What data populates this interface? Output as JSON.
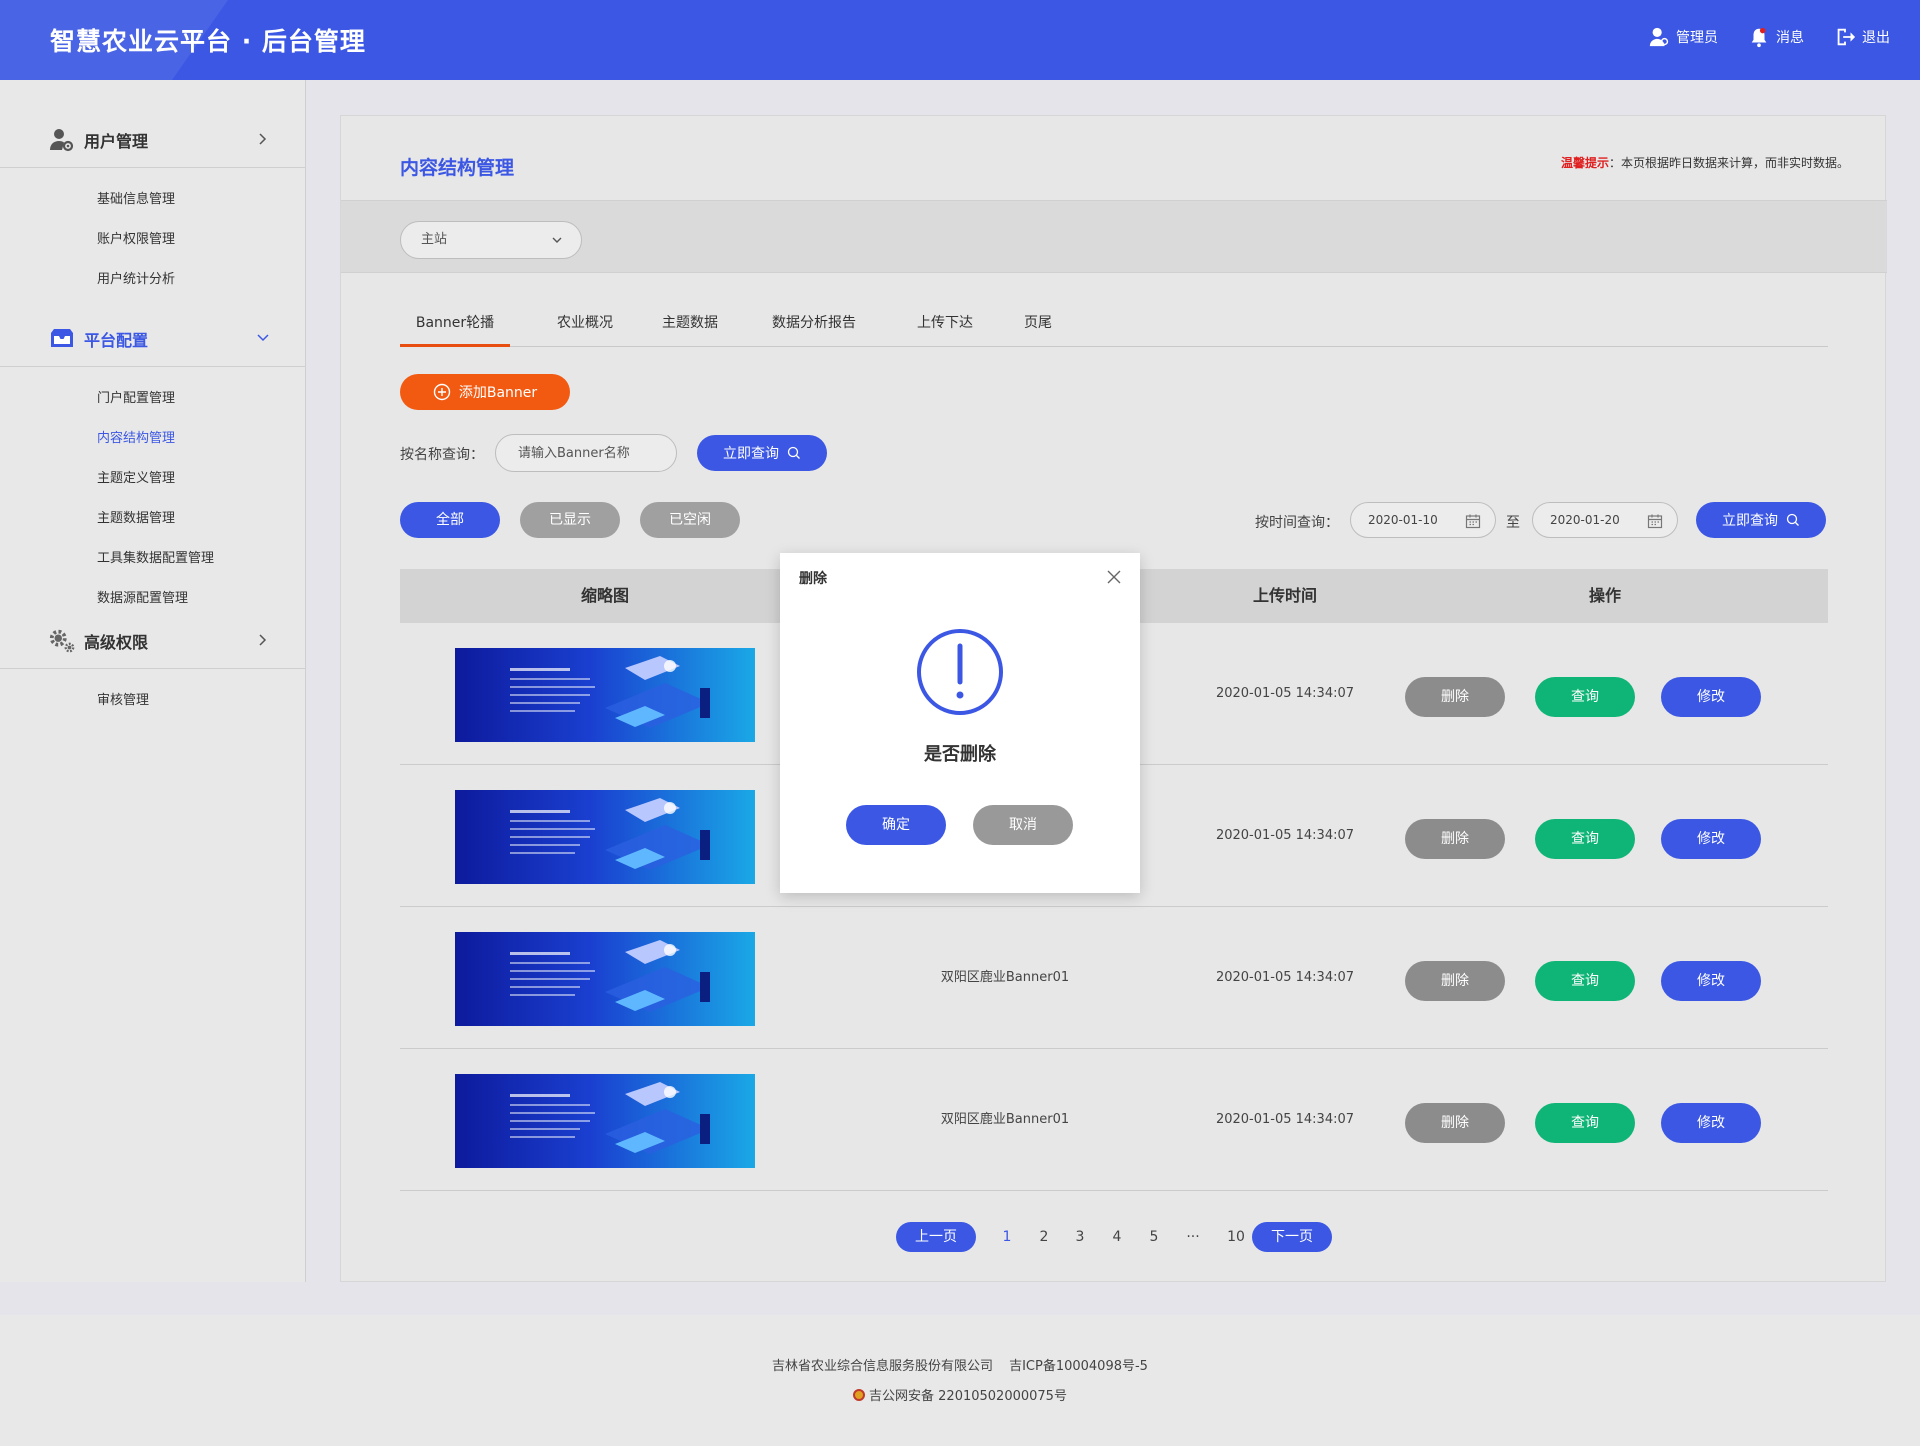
{
  "header": {
    "app_title": "智慧农业云平台 · 后台管理",
    "admin_label": "管理员",
    "messages_label": "消息",
    "logout_label": "退出"
  },
  "sidebar": {
    "groups": [
      {
        "label": "用户管理",
        "icon": "user-gear-icon",
        "expanded": false,
        "items": [
          "基础信息管理",
          "账户权限管理",
          "用户统计分析"
        ]
      },
      {
        "label": "平台配置",
        "icon": "inbox-icon",
        "expanded": true,
        "items": [
          "门户配置管理",
          "内容结构管理",
          "主题定义管理",
          "主题数据管理",
          "工具集数据配置管理",
          "数据源配置管理"
        ]
      },
      {
        "label": "高级权限",
        "icon": "gears-icon",
        "expanded": false,
        "items": [
          "审核管理"
        ]
      }
    ],
    "active_item": "内容结构管理"
  },
  "main": {
    "page_title": "内容结构管理",
    "tip_key": "温馨提示",
    "tip_text": "：本页根据昨日数据来计算，而非实时数据。",
    "site_select_value": "主站",
    "tabs": [
      "Banner轮播",
      "农业概况",
      "主题数据",
      "数据分析报告",
      "上传下达",
      "页尾"
    ],
    "active_tab": "Banner轮播",
    "add_button": "添加Banner",
    "name_query_label": "按名称查询：",
    "name_query_placeholder": "请输入Banner名称",
    "query_button": "立即查询",
    "status_filters": [
      "全部",
      "已显示",
      "已空闲"
    ],
    "active_status": "全部",
    "time_query_label": "按时间查询：",
    "date_from": "2020-01-10",
    "date_to_label": "至",
    "date_to": "2020-01-20",
    "table": {
      "columns": [
        "缩略图",
        "",
        "上传时间",
        "操作"
      ],
      "rows": [
        {
          "name": "",
          "upload_time": "2020-01-05    14:34:07"
        },
        {
          "name": "",
          "upload_time": "2020-01-05    14:34:07"
        },
        {
          "name": "双阳区鹿业Banner01",
          "upload_time": "2020-01-05    14:34:07"
        },
        {
          "name": "双阳区鹿业Banner01",
          "upload_time": "2020-01-05    14:34:07"
        }
      ],
      "action_delete": "删除",
      "action_view": "查询",
      "action_edit": "修改"
    },
    "pagination": {
      "prev": "上一页",
      "pages": [
        "1",
        "2",
        "3",
        "4",
        "5",
        "···",
        "10"
      ],
      "current": "1",
      "next": "下一页"
    }
  },
  "modal": {
    "title": "删除",
    "message": "是否删除",
    "confirm": "确定",
    "cancel": "取消"
  },
  "footer": {
    "company": "吉林省农业综合信息服务股份有限公司",
    "icp": "吉ICP备10004098号-5",
    "police_record": "吉公网安备 22010502000075号"
  },
  "colors": {
    "primary": "#3b57e4",
    "accent_orange": "#f25a12",
    "success_green": "#0fb576",
    "muted_gray": "#8c8c8c",
    "tip_red": "#e02020"
  }
}
